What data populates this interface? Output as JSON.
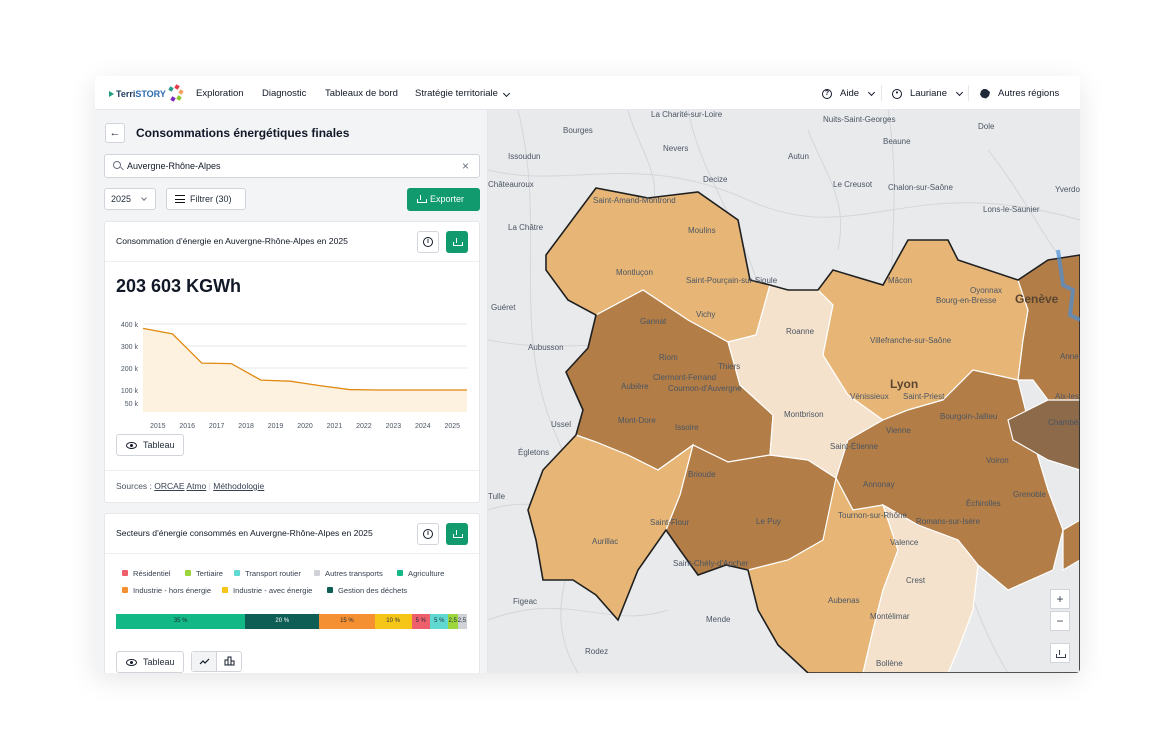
{
  "topnav": {
    "logo_a": "Terri",
    "logo_b": "STORY",
    "items": [
      "Exploration",
      "Diagnostic",
      "Tableaux de bord",
      "Stratégie territoriale"
    ],
    "aide": "Aide",
    "user": "Lauriane",
    "regions": "Autres régions"
  },
  "panel": {
    "title": "Consommations énergétiques finales",
    "search_value": "Auvergne-Rhône-Alpes",
    "year": "2025",
    "filter_label": "Filtrer (30)",
    "export_label": "Exporter"
  },
  "card1": {
    "title": "Consommation d'énergie en Auvergne-Rhône-Alpes en 2025",
    "value": "203 603 KGWh",
    "tableau_label": "Tableau",
    "sources_prefix": "Sources :",
    "sources": [
      "ORCAE",
      "Atmo"
    ],
    "methodologie": "Méthodologie"
  },
  "chart_data": {
    "type": "area",
    "categories": [
      "2015",
      "2016",
      "2017",
      "2018",
      "2019",
      "2020",
      "2021",
      "2022",
      "2023",
      "2024",
      "2025"
    ],
    "y_ticks": [
      "400 k",
      "300 k",
      "200 k",
      "100 k",
      "50 k"
    ],
    "y_tick_values": [
      400000,
      300000,
      200000,
      100000,
      0
    ],
    "series": [
      {
        "values": [
          380000,
          355000,
          222000,
          220000,
          145000,
          140000,
          120000,
          102000,
          100000,
          100000
        ]
      }
    ],
    "ylim": [
      0,
      400000
    ],
    "color": "#e08a12",
    "fill": "#fdf1df"
  },
  "card2": {
    "title": "Secteurs d'énergie consommés en Auvergne-Rhône-Alpes en 2025",
    "legend": [
      {
        "label": "Résidentiel",
        "color": "#ef5f6b"
      },
      {
        "label": "Tertiaire",
        "color": "#9ad63c"
      },
      {
        "label": "Transport routier",
        "color": "#5fd9d2"
      },
      {
        "label": "Autres transports",
        "color": "#cfd3d8"
      },
      {
        "label": "Agriculture",
        "color": "#12b886"
      },
      {
        "label": "Industrie - hors énergie",
        "color": "#f59032"
      },
      {
        "label": "Industrie - avec énergie",
        "color": "#f5c518"
      },
      {
        "label": "Gestion des déchets",
        "color": "#0e5e55"
      }
    ],
    "segments": [
      {
        "label": "35 %",
        "value": 35,
        "color": "#12b886"
      },
      {
        "label": "20 %",
        "value": 20,
        "color": "#0e5e55",
        "text": "#ffffff"
      },
      {
        "label": "15 %",
        "value": 15,
        "color": "#f59032"
      },
      {
        "label": "10 %",
        "value": 10,
        "color": "#f5c518"
      },
      {
        "label": "5 %",
        "value": 5,
        "color": "#ef5f6b"
      },
      {
        "label": "5 %",
        "value": 5,
        "color": "#5fd9d2"
      },
      {
        "label": "2,5 %",
        "value": 2.5,
        "color": "#9ad63c"
      },
      {
        "label": "2,5 %",
        "value": 2.5,
        "color": "#cfd3d8"
      }
    ],
    "tableau_label": "Tableau"
  },
  "map": {
    "labels": [
      "La Charité-sur-Loire",
      "Nuits-Saint-Georges",
      "Bourges",
      "Dole",
      "Nevers",
      "Issoudun",
      "Beaune",
      "Decize",
      "Autun",
      "Le Creusot",
      "Chalon-sur-Saône",
      "Lons-le-Saunier",
      "Châteauroux",
      "Yverdon",
      "Saint-Amand-Montrond",
      "Moulins",
      "La Châtre",
      "Montluçon",
      "Saint-Pourçain-sur-Sioule",
      "Mâcon",
      "Oyonnax",
      "Bourg-en-Bresse",
      "Genève",
      "Guéret",
      "Gannat",
      "Vichy",
      "Roanne",
      "Villefranche-sur-Saône",
      "Aubusson",
      "Riom",
      "Thiers",
      "Aubière",
      "Clermont-Ferrand",
      "Cournon-d'Auvergne",
      "Lyon",
      "Vénissieux",
      "Saint-Priest",
      "Annecy",
      "Aix-les-Bains",
      "Ussel",
      "Mont-Dore",
      "Issoire",
      "Montbrison",
      "Vienne",
      "Bourgoin-Jallieu",
      "Chambéry",
      "Égletons",
      "Saint-Étienne",
      "Brioude",
      "Voiron",
      "Tulle",
      "Annonay",
      "Grenoble",
      "Échirolles",
      "Saint-Flour",
      "Le Puy",
      "Tournon-sur-Rhône",
      "Romans-sur-Isère",
      "Aurillac",
      "Valence",
      "Saint-Chély-d'Apcher",
      "Crest",
      "Figeac",
      "Aubenas",
      "Mende",
      "Montélimar",
      "Rodez",
      "Bollène"
    ],
    "zoom_in": "+",
    "zoom_out": "−"
  }
}
